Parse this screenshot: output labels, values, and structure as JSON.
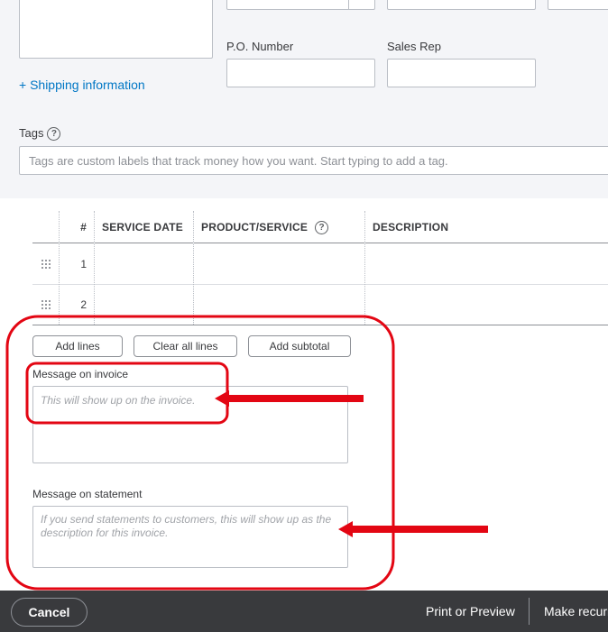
{
  "form": {
    "po_number_label": "P.O. Number",
    "sales_rep_label": "Sales Rep",
    "shipping_link": "+ Shipping information",
    "tags_label": "Tags",
    "tags_placeholder": "Tags are custom labels that track money how you want. Start typing to add a tag."
  },
  "table": {
    "columns": [
      "#",
      "SERVICE DATE",
      "PRODUCT/SERVICE",
      "DESCRIPTION"
    ],
    "rows": [
      {
        "num": "1"
      },
      {
        "num": "2"
      }
    ]
  },
  "actions": {
    "add_lines": "Add lines",
    "clear_all_lines": "Clear all lines",
    "add_subtotal": "Add subtotal"
  },
  "messages": {
    "invoice_label": "Message on invoice",
    "invoice_placeholder": "This will show up on the invoice.",
    "statement_label": "Message on statement",
    "statement_placeholder": "If you send statements to customers, this will show up as the description for this invoice."
  },
  "footer": {
    "cancel": "Cancel",
    "print_preview": "Print or Preview",
    "make_recurring": "Make recurring"
  },
  "annotation": {
    "color": "#e30613"
  },
  "icons": {
    "help": "question-circle-icon",
    "grip": "drag-handle-icon"
  }
}
